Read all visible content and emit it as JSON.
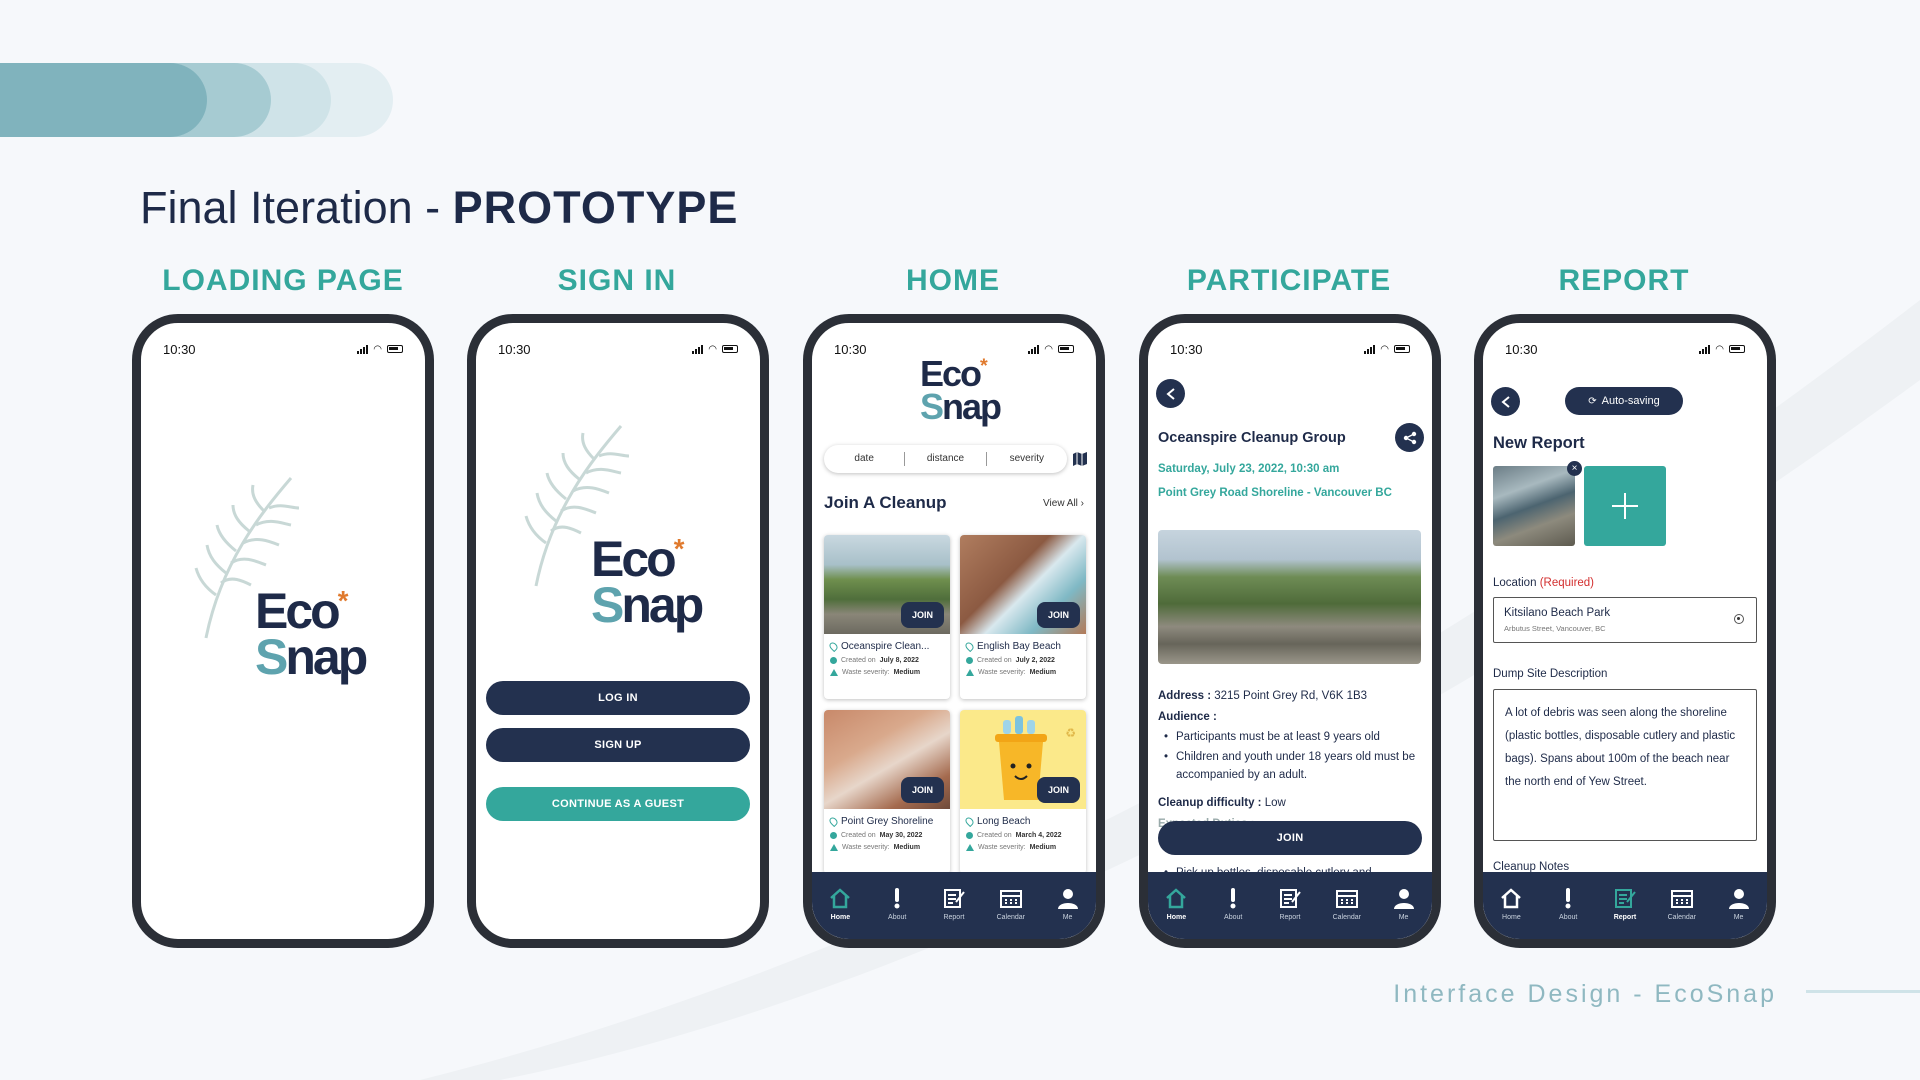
{
  "heading": {
    "light": "Final Iteration - ",
    "bold": "PROTOTYPE"
  },
  "screens": [
    {
      "title": "LOADING PAGE",
      "time": "10:30"
    },
    {
      "title": "SIGN IN",
      "time": "10:30",
      "buttons": [
        "LOG IN",
        "SIGN UP",
        "CONTINUE AS A GUEST"
      ]
    },
    {
      "title": "HOME",
      "time": "10:30",
      "filters": [
        "date",
        "distance",
        "severity"
      ],
      "section": "Join A Cleanup",
      "view_all": "View All ›",
      "cards": [
        {
          "name": "Oceanspire Clean...",
          "created_label": "Created on",
          "created": "July 8, 2022",
          "severity_label": "Waste severity:",
          "severity": "Medium",
          "join": "JOIN"
        },
        {
          "name": "English Bay Beach",
          "created_label": "Created on",
          "created": "July 2, 2022",
          "severity_label": "Waste severity:",
          "severity": "Medium",
          "join": "JOIN"
        },
        {
          "name": "Point Grey Shoreline",
          "created_label": "Created on",
          "created": "May 30, 2022",
          "severity_label": "Waste severity:",
          "severity": "Medium",
          "join": "JOIN"
        },
        {
          "name": "Long Beach",
          "created_label": "Created on",
          "created": "March 4, 2022",
          "severity_label": "Waste severity:",
          "severity": "Medium",
          "join": "JOIN"
        }
      ]
    },
    {
      "title": "PARTICIPATE",
      "time": "10:30",
      "group": "Oceanspire Cleanup Group",
      "datetime": "Saturday, July 23, 2022, 10:30 am",
      "place": "Point Grey Road Shoreline - Vancouver BC",
      "address_label": "Address :",
      "address": "3215 Point Grey Rd, V6K 1B3",
      "audience_label": "Audience :",
      "audience": [
        "Participants must be at least 9 years old",
        "Children and youth under 18 years old must be accompanied by an adult."
      ],
      "difficulty_label": "Cleanup difficulty :",
      "difficulty": "Low",
      "tasks_label": "Expected Duties :",
      "task": "Pick up bottles, disposable cutlery and",
      "join": "JOIN"
    },
    {
      "title": "REPORT",
      "time": "10:30",
      "autosave": "Auto-saving",
      "heading": "New Report",
      "location_label": "Location",
      "required": "(Required)",
      "location_name": "Kitsilano Beach Park",
      "location_sub": "Arbutus Street, Vancouver, BC",
      "desc_label": "Dump Site Description",
      "description": "A lot of debris was seen along the shoreline (plastic bottles, disposable cutlery and plastic bags). Spans about 100m of the beach near the north end of Yew Street.",
      "notes_label": "Cleanup Notes"
    }
  ],
  "nav": [
    "Home",
    "About",
    "Report",
    "Calendar",
    "Me"
  ],
  "footer": "Interface Design - EcoSnap",
  "logo": {
    "eco": "Eco",
    "snap": "S",
    "nap": "nap",
    "asterisk": "*"
  },
  "colors": {
    "navy": "#23314f",
    "teal": "#34a79c",
    "accent": "#e07a2e"
  }
}
